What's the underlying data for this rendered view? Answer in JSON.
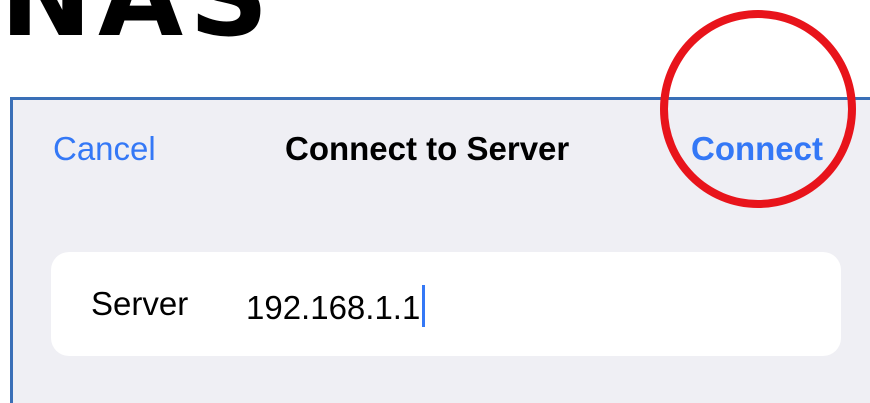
{
  "heading": {
    "text": "NAS"
  },
  "dialog": {
    "cancel_label": "Cancel",
    "title": "Connect to Server",
    "connect_label": "Connect",
    "server_label": "Server",
    "server_value": "192.168.1.1"
  },
  "annotation": {
    "shape": "circle",
    "color": "#e8141b"
  },
  "colors": {
    "accent": "#3478f6",
    "sheet_background": "#efeff4",
    "field_background": "#ffffff"
  }
}
